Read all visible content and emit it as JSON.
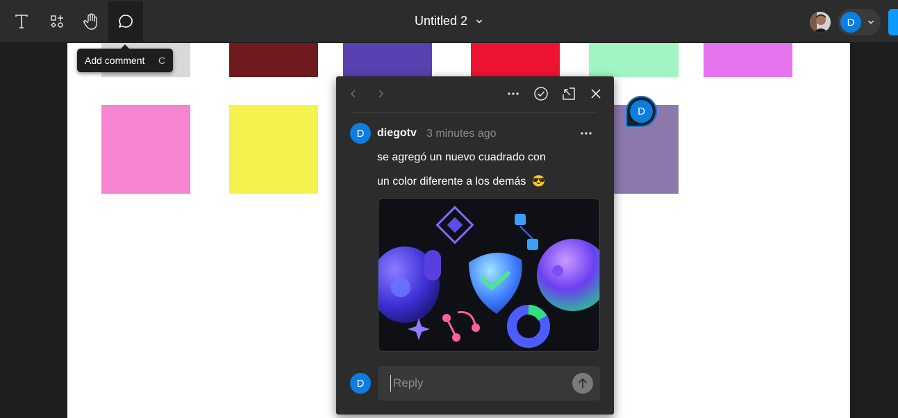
{
  "toolbar": {
    "tools": [
      {
        "name": "text-tool",
        "icon": "text-icon"
      },
      {
        "name": "resources-tool",
        "icon": "shapes-plus-icon"
      },
      {
        "name": "hand-tool",
        "icon": "hand-icon"
      },
      {
        "name": "comment-tool",
        "icon": "comment-bubble-icon",
        "active": true
      }
    ],
    "doc_title": "Untitled 2",
    "title_icon": "chevron-down-icon",
    "user_initial": "D"
  },
  "tooltip": {
    "label": "Add comment",
    "shortcut": "C"
  },
  "canvas": {
    "swatch_colors_row1": [
      "#d9d9d9",
      "#6f1a1d",
      "#5a41b2",
      "#ef1332",
      "#a1f5c3",
      "#e774ef"
    ],
    "swatch_colors_row2": [
      "#f584d1",
      "#f6f24d",
      "#8c78ad"
    ],
    "pin_initial": "D"
  },
  "comment": {
    "nav_icons": [
      "chevron-left-icon",
      "chevron-right-icon"
    ],
    "action_icons": [
      "more-icon",
      "resolve-check-icon",
      "open-external-icon",
      "close-icon"
    ],
    "author_initial": "D",
    "author": "diegotv",
    "time": "3 minutes ago",
    "message_line1": "se agregó un nuevo cuadrado con",
    "message_line2": "un color diferente a los demás",
    "emoji": "😎",
    "reply_initial": "D",
    "reply_placeholder": "Reply"
  },
  "colors": {
    "accent": "#0c7de1",
    "panel_bg": "#2c2c2c",
    "toolbar_bg": "#2c2c2c"
  }
}
